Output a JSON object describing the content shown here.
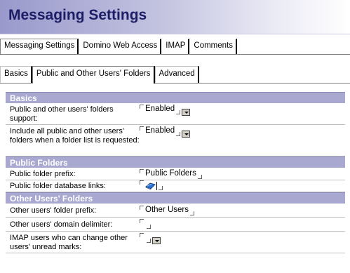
{
  "header": {
    "title": "Messaging Settings"
  },
  "tabs": [
    {
      "label": "Messaging Settings"
    },
    {
      "label": "Domino Web Access"
    },
    {
      "label": "IMAP"
    },
    {
      "label": "Comments"
    }
  ],
  "subtabs": [
    {
      "label": "Basics"
    },
    {
      "label": "Public and Other Users' Folders"
    },
    {
      "label": "Advanced"
    }
  ],
  "sections": {
    "basics": {
      "title": "Basics",
      "rows": [
        {
          "label": "Public and other users' folders support:",
          "value": "Enabled"
        },
        {
          "label": "Include all public and other users' folders when a folder list is requested:",
          "value": "Enabled"
        }
      ]
    },
    "public_folders": {
      "title": "Public Folders",
      "rows": [
        {
          "label": "Public folder prefix:",
          "value": "Public Folders"
        },
        {
          "label": "Public folder database links:",
          "value": ""
        }
      ]
    },
    "other_users": {
      "title": "Other Users' Folders",
      "rows": [
        {
          "label": "Other users' folder prefix:",
          "value": "Other Users"
        },
        {
          "label": "Other users' domain delimiter:",
          "value": ""
        },
        {
          "label": "IMAP users who can change other users' unread marks:",
          "value": ""
        }
      ]
    }
  },
  "icons": {
    "dropdown": "chevron-down-icon",
    "doclink": "database-link-icon"
  },
  "colors": {
    "section_header": "#a8a8d0",
    "title": "#1d1d66"
  }
}
